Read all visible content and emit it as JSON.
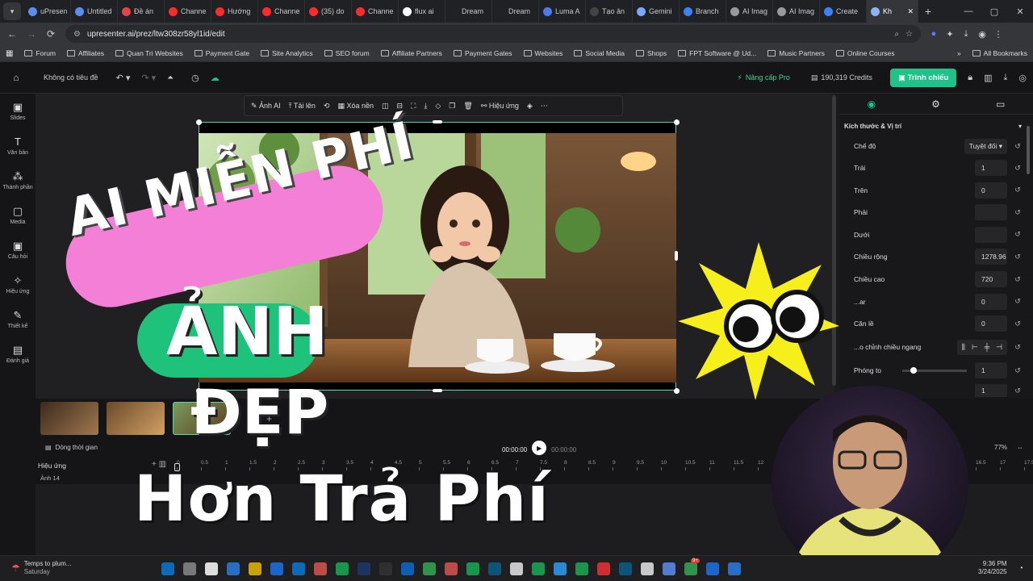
{
  "browser": {
    "tabs": [
      "uPresen",
      "Untitled",
      "Đề án",
      "Channe",
      "Hướng",
      "Channe",
      "(35) do",
      "Channe",
      "flux ai",
      "Dream",
      "Dream",
      "Luma A",
      "Tạo ản",
      "Gemini",
      "Branch",
      "AI Imag",
      "AI Imag",
      "Create",
      "Kh"
    ],
    "tab_colors": [
      "#5a8df0",
      "#5a8df0",
      "#e04444",
      "#ff2a2a",
      "#ff2a2a",
      "#ff2a2a",
      "#ff2a2a",
      "#ff2a2a",
      "#ffffff",
      "#222",
      "#222",
      "#4b7bec",
      "#444",
      "#7aa7ff",
      "#3b82f6",
      "#999",
      "#999",
      "#3b82f6",
      "#8ab4f8"
    ],
    "url": "upresenter.ai/prez/ltw308zr58yl1id/edit",
    "bookmarks": [
      "Forum",
      "Affiliates",
      "Quan Tri Websites",
      "Payment Gate",
      "Site Analytics",
      "SEO forum",
      "Affiliate Partners",
      "Payment Gates",
      "Websites",
      "Social Media",
      "Shops",
      "FPT Software @ Ud...",
      "Music Partners",
      "Online Courses"
    ],
    "all_bookmarks": "All Bookmarks"
  },
  "app": {
    "doc_title": "Không có tiêu đề",
    "upgrade": "Nâng cấp Pro",
    "credits": "190,319 Credits",
    "present_button": "Trình chiếu",
    "accent": "#1fc28a"
  },
  "rail": [
    "Slides",
    "Văn bản",
    "Thành phần",
    "Media",
    "Câu hỏi",
    "Hiệu ứng",
    "Thiết kế",
    "Đánh giá"
  ],
  "toolbar": {
    "ai_image": "Ảnh AI",
    "upload": "Tải lên",
    "remove_bg": "Xóa nền",
    "effects": "Hiệu ứng"
  },
  "panel": {
    "section": "Kích thước & Vị trí",
    "mode_label": "Chế độ",
    "mode_value": "Tuyệt đối",
    "rows": [
      {
        "label": "Trái",
        "value": "1"
      },
      {
        "label": "Trên",
        "value": "0"
      },
      {
        "label": "Phải",
        "value": ""
      },
      {
        "label": "Dưới",
        "value": ""
      },
      {
        "label": "Chiều rộng",
        "value": "1278.96"
      },
      {
        "label": "Chiều cao",
        "value": "720"
      },
      {
        "label": "...ar",
        "value": "0"
      },
      {
        "label": "Căn lề",
        "value": "0"
      }
    ],
    "align_label": "...o chỉnh chiều ngang",
    "zoom_label": "Phóng to",
    "zoom_value": "1",
    "last_value": "1"
  },
  "timeline": {
    "track_toggle": "Dòng thời gian",
    "time_current": "00:00:00",
    "time_total": "00:00:00",
    "zoom": "77%",
    "effects_label": "Hiệu ứng",
    "layer_label": "Ảnh 14",
    "ticks": [
      "0",
      "0.5",
      "1",
      "1.5",
      "2",
      "2.5",
      "3",
      "3.5",
      "4",
      "4.5",
      "5",
      "5.5",
      "6",
      "6.5",
      "7",
      "7.5",
      "8",
      "8.5",
      "9",
      "9.5",
      "10",
      "10.5",
      "11",
      "11.5",
      "12",
      "12.5",
      "13",
      "13.5",
      "14",
      "14.5",
      "15",
      "15.5",
      "16",
      "16.5",
      "17",
      "17.5"
    ]
  },
  "overlay": {
    "line1": "AI MIỄN PHÍ",
    "line2": "ẢNH",
    "line3": "ĐẸP",
    "line4": "Hơn Trả Phí",
    "pink": "#f47fd6",
    "green": "#1fc27a",
    "yellow": "#f6ef1c"
  },
  "taskbar": {
    "weather": "Temps to plum...",
    "weather_day": "Saturday",
    "time": "9:36 PM",
    "date": "3/24/2025",
    "badge": "9+"
  }
}
